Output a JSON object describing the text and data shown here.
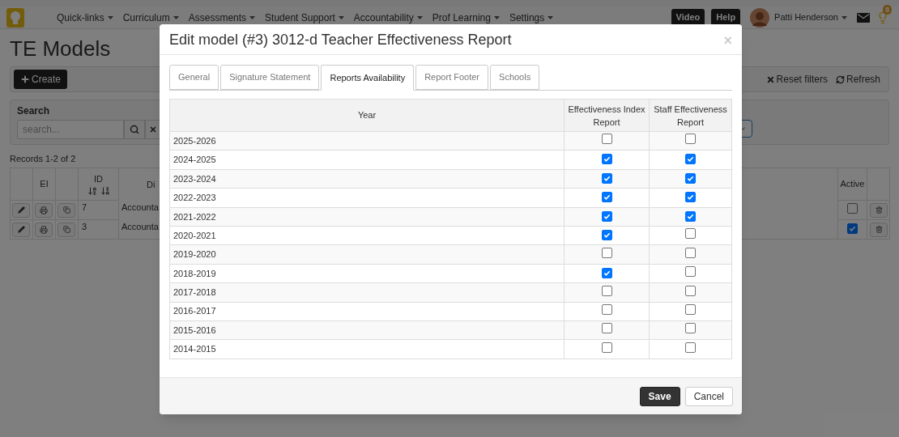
{
  "navbar": {
    "items": [
      "Quick-links",
      "Curriculum",
      "Assessments",
      "Student Support",
      "Accountability",
      "Prof Learning",
      "Settings"
    ],
    "buttons": [
      "Video",
      "Help"
    ],
    "user": "Patti Henderson",
    "notification_count": "8"
  },
  "page": {
    "title": "TE Models",
    "create": "Create",
    "reset": "Reset filters",
    "refresh": "Refresh",
    "search_label": "Search",
    "search_placeholder": "search...",
    "records": "Records 1-2 of 2",
    "columns": [
      "EI",
      "ID",
      "Di",
      "Active"
    ],
    "rows": [
      {
        "id": "7",
        "description": "Accounta",
        "active": false
      },
      {
        "id": "3",
        "description": "Accounta",
        "active": true
      }
    ]
  },
  "modal": {
    "title": "Edit model (#3) 3012-d Teacher Effectiveness Report",
    "close": "×",
    "tabs": [
      {
        "label": "General",
        "selected": false
      },
      {
        "label": "Signature Statement",
        "selected": false
      },
      {
        "label": "Reports Availability",
        "selected": true
      },
      {
        "label": "Report Footer",
        "selected": false
      },
      {
        "label": "Schools",
        "selected": false
      }
    ],
    "columns": [
      "Year",
      "Effectiveness Index Report",
      "Staff Effectiveness Report"
    ],
    "rows": [
      {
        "year": "2025-2026",
        "effectiveness_index": false,
        "staff_effectiveness": false
      },
      {
        "year": "2024-2025",
        "effectiveness_index": true,
        "staff_effectiveness": true
      },
      {
        "year": "2023-2024",
        "effectiveness_index": true,
        "staff_effectiveness": true
      },
      {
        "year": "2022-2023",
        "effectiveness_index": true,
        "staff_effectiveness": true
      },
      {
        "year": "2021-2022",
        "effectiveness_index": true,
        "staff_effectiveness": true
      },
      {
        "year": "2020-2021",
        "effectiveness_index": true,
        "staff_effectiveness": false
      },
      {
        "year": "2019-2020",
        "effectiveness_index": false,
        "staff_effectiveness": false
      },
      {
        "year": "2018-2019",
        "effectiveness_index": true,
        "staff_effectiveness": false
      },
      {
        "year": "2017-2018",
        "effectiveness_index": false,
        "staff_effectiveness": false
      },
      {
        "year": "2016-2017",
        "effectiveness_index": false,
        "staff_effectiveness": false
      },
      {
        "year": "2015-2016",
        "effectiveness_index": false,
        "staff_effectiveness": false
      },
      {
        "year": "2014-2015",
        "effectiveness_index": false,
        "staff_effectiveness": false
      }
    ],
    "buttons": [
      {
        "label": "Save",
        "kind": "primary"
      },
      {
        "label": "Cancel",
        "kind": "default"
      }
    ]
  }
}
